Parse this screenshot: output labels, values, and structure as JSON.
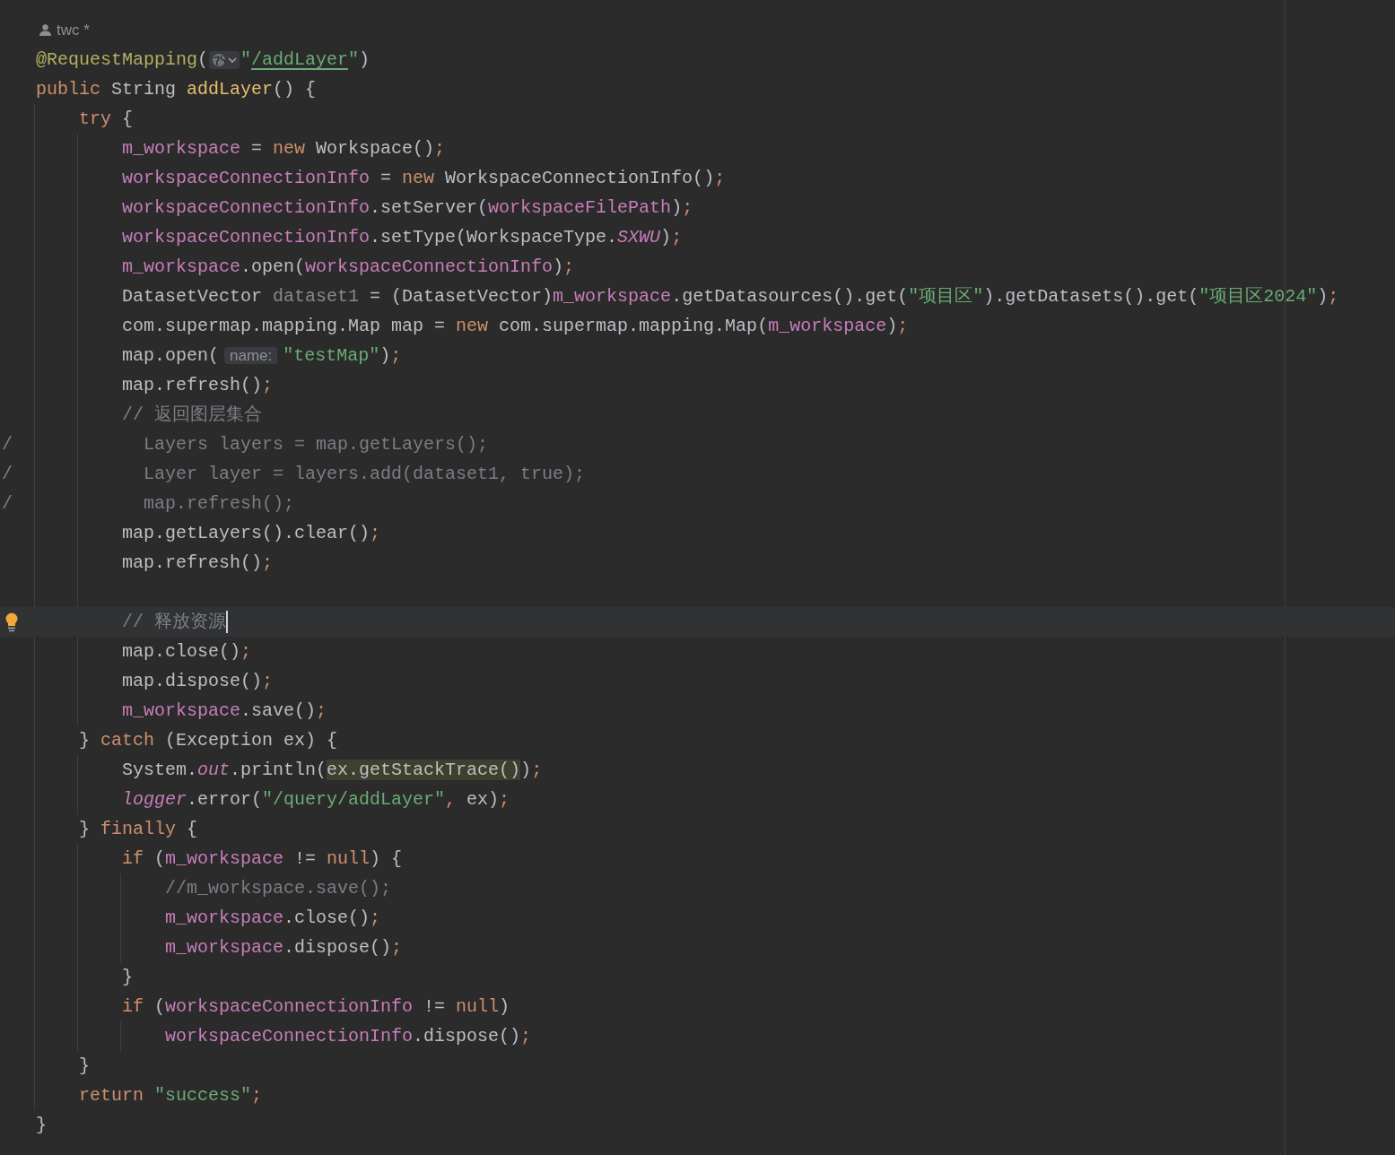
{
  "author": {
    "name": "twc *"
  },
  "lines": [
    {
      "kind": "code",
      "tokens": [
        {
          "kind": "ann",
          "text": "@RequestMapping"
        },
        {
          "kind": "plain",
          "text": "("
        },
        {
          "kind": "web-icon"
        },
        {
          "kind": "str",
          "text": "\""
        },
        {
          "kind": "link",
          "text": "/addLayer"
        },
        {
          "kind": "str",
          "text": "\""
        },
        {
          "kind": "plain",
          "text": ")"
        }
      ]
    },
    {
      "kind": "code",
      "tokens": [
        {
          "kind": "kw",
          "text": "public "
        },
        {
          "kind": "plain",
          "text": "String "
        },
        {
          "kind": "decl",
          "text": "addLayer"
        },
        {
          "kind": "plain",
          "text": "() {"
        }
      ],
      "children": [
        {
          "kind": "code",
          "tokens": [
            {
              "kind": "kw",
              "text": "try "
            },
            {
              "kind": "plain",
              "text": "{"
            }
          ],
          "children": [
            {
              "kind": "code",
              "tokens": [
                {
                  "kind": "field",
                  "text": "m_workspace"
                },
                {
                  "kind": "plain",
                  "text": " = "
                },
                {
                  "kind": "kw",
                  "text": "new "
                },
                {
                  "kind": "plain",
                  "text": "Workspace()"
                },
                {
                  "kind": "punct",
                  "text": ";"
                }
              ]
            },
            {
              "kind": "code",
              "tokens": [
                {
                  "kind": "field",
                  "text": "workspaceConnectionInfo"
                },
                {
                  "kind": "plain",
                  "text": " = "
                },
                {
                  "kind": "kw",
                  "text": "new "
                },
                {
                  "kind": "plain",
                  "text": "WorkspaceConnectionInfo()"
                },
                {
                  "kind": "punct",
                  "text": ";"
                }
              ]
            },
            {
              "kind": "code",
              "tokens": [
                {
                  "kind": "field",
                  "text": "workspaceConnectionInfo"
                },
                {
                  "kind": "plain",
                  "text": ".setServer("
                },
                {
                  "kind": "field",
                  "text": "workspaceFilePath"
                },
                {
                  "kind": "plain",
                  "text": ")"
                },
                {
                  "kind": "punct",
                  "text": ";"
                }
              ]
            },
            {
              "kind": "code",
              "tokens": [
                {
                  "kind": "field",
                  "text": "workspaceConnectionInfo"
                },
                {
                  "kind": "plain",
                  "text": ".setType(WorkspaceType."
                },
                {
                  "kind": "static",
                  "text": "SXWU"
                },
                {
                  "kind": "plain",
                  "text": ")"
                },
                {
                  "kind": "punct",
                  "text": ";"
                }
              ]
            },
            {
              "kind": "code",
              "tokens": [
                {
                  "kind": "field",
                  "text": "m_workspace"
                },
                {
                  "kind": "plain",
                  "text": ".open("
                },
                {
                  "kind": "field",
                  "text": "workspaceConnectionInfo"
                },
                {
                  "kind": "plain",
                  "text": ")"
                },
                {
                  "kind": "punct",
                  "text": ";"
                }
              ]
            },
            {
              "kind": "code",
              "tokens": [
                {
                  "kind": "plain",
                  "text": "DatasetVector "
                },
                {
                  "kind": "unused",
                  "text": "dataset1"
                },
                {
                  "kind": "plain",
                  "text": " = (DatasetVector)"
                },
                {
                  "kind": "field",
                  "text": "m_workspace"
                },
                {
                  "kind": "plain",
                  "text": ".getDatasources().get("
                },
                {
                  "kind": "str",
                  "text": "\"项目区\""
                },
                {
                  "kind": "plain",
                  "text": ").getDatasets().get("
                },
                {
                  "kind": "str",
                  "text": "\"项目区2024\""
                },
                {
                  "kind": "plain",
                  "text": ")"
                },
                {
                  "kind": "punct",
                  "text": ";"
                }
              ]
            },
            {
              "kind": "code",
              "tokens": [
                {
                  "kind": "plain",
                  "text": "com.supermap.mapping.Map map = "
                },
                {
                  "kind": "kw",
                  "text": "new "
                },
                {
                  "kind": "plain",
                  "text": "com.supermap.mapping.Map("
                },
                {
                  "kind": "field",
                  "text": "m_workspace"
                },
                {
                  "kind": "plain",
                  "text": ")"
                },
                {
                  "kind": "punct",
                  "text": ";"
                }
              ]
            },
            {
              "kind": "code",
              "tokens": [
                {
                  "kind": "plain",
                  "text": "map.open("
                },
                {
                  "kind": "hint",
                  "text": "name:"
                },
                {
                  "kind": "str",
                  "text": "\"testMap\""
                },
                {
                  "kind": "plain",
                  "text": ")"
                },
                {
                  "kind": "punct",
                  "text": ";"
                }
              ]
            },
            {
              "kind": "code",
              "tokens": [
                {
                  "kind": "plain",
                  "text": "map.refresh()"
                },
                {
                  "kind": "punct",
                  "text": ";"
                }
              ]
            },
            {
              "kind": "code",
              "tokens": [
                {
                  "kind": "comment",
                  "text": "// 返回图层集合"
                }
              ]
            },
            {
              "kind": "commented",
              "marker": "/",
              "tokens": [
                {
                  "kind": "comment",
                  "text": "Layers layers = map.getLayers();"
                }
              ]
            },
            {
              "kind": "commented",
              "marker": "/",
              "tokens": [
                {
                  "kind": "comment",
                  "text": "Layer layer = layers.add(dataset1, true);"
                }
              ]
            },
            {
              "kind": "commented",
              "marker": "/",
              "tokens": [
                {
                  "kind": "comment",
                  "text": "map.refresh();"
                }
              ]
            },
            {
              "kind": "code",
              "tokens": [
                {
                  "kind": "plain",
                  "text": "map.getLayers().clear()"
                },
                {
                  "kind": "punct",
                  "text": ";"
                }
              ]
            },
            {
              "kind": "code",
              "tokens": [
                {
                  "kind": "plain",
                  "text": "map.refresh()"
                },
                {
                  "kind": "punct",
                  "text": ";"
                }
              ]
            },
            {
              "kind": "blank"
            },
            {
              "kind": "current",
              "tokens": [
                {
                  "kind": "comment",
                  "text": "// 释放资源"
                }
              ]
            },
            {
              "kind": "code",
              "tokens": [
                {
                  "kind": "plain",
                  "text": "map.close()"
                },
                {
                  "kind": "punct",
                  "text": ";"
                }
              ]
            },
            {
              "kind": "code",
              "tokens": [
                {
                  "kind": "plain",
                  "text": "map.dispose()"
                },
                {
                  "kind": "punct",
                  "text": ";"
                }
              ]
            },
            {
              "kind": "code",
              "tokens": [
                {
                  "kind": "field",
                  "text": "m_workspace"
                },
                {
                  "kind": "plain",
                  "text": ".save()"
                },
                {
                  "kind": "punct",
                  "text": ";"
                }
              ]
            }
          ]
        },
        {
          "kind": "code",
          "tokens": [
            {
              "kind": "plain",
              "text": "} "
            },
            {
              "kind": "kw",
              "text": "catch "
            },
            {
              "kind": "plain",
              "text": "(Exception ex) {"
            }
          ],
          "children": [
            {
              "kind": "code",
              "tokens": [
                {
                  "kind": "plain",
                  "text": "System."
                },
                {
                  "kind": "static",
                  "text": "out"
                },
                {
                  "kind": "plain",
                  "text": ".println("
                },
                {
                  "kind": "match",
                  "text": "ex.getStackTrace()"
                },
                {
                  "kind": "plain",
                  "text": ")"
                },
                {
                  "kind": "punct",
                  "text": ";"
                }
              ]
            },
            {
              "kind": "code",
              "tokens": [
                {
                  "kind": "static",
                  "text": "logger"
                },
                {
                  "kind": "plain",
                  "text": ".error("
                },
                {
                  "kind": "str",
                  "text": "\"/query/addLayer\""
                },
                {
                  "kind": "punct",
                  "text": ", "
                },
                {
                  "kind": "plain",
                  "text": "ex)"
                },
                {
                  "kind": "punct",
                  "text": ";"
                }
              ]
            }
          ]
        },
        {
          "kind": "code",
          "tokens": [
            {
              "kind": "plain",
              "text": "} "
            },
            {
              "kind": "kw",
              "text": "finally "
            },
            {
              "kind": "plain",
              "text": "{"
            }
          ],
          "children": [
            {
              "kind": "code",
              "tokens": [
                {
                  "kind": "kw",
                  "text": "if "
                },
                {
                  "kind": "plain",
                  "text": "("
                },
                {
                  "kind": "field",
                  "text": "m_workspace"
                },
                {
                  "kind": "plain",
                  "text": " != "
                },
                {
                  "kind": "kw",
                  "text": "null"
                },
                {
                  "kind": "plain",
                  "text": ") {"
                }
              ],
              "children": [
                {
                  "kind": "code",
                  "tokens": [
                    {
                      "kind": "comment",
                      "text": "//m_workspace.save();"
                    }
                  ]
                },
                {
                  "kind": "code",
                  "tokens": [
                    {
                      "kind": "field",
                      "text": "m_workspace"
                    },
                    {
                      "kind": "plain",
                      "text": ".close()"
                    },
                    {
                      "kind": "punct",
                      "text": ";"
                    }
                  ]
                },
                {
                  "kind": "code",
                  "tokens": [
                    {
                      "kind": "field",
                      "text": "m_workspace"
                    },
                    {
                      "kind": "plain",
                      "text": ".dispose()"
                    },
                    {
                      "kind": "punct",
                      "text": ";"
                    }
                  ]
                }
              ]
            },
            {
              "kind": "code",
              "tokens": [
                {
                  "kind": "plain",
                  "text": "}"
                }
              ]
            },
            {
              "kind": "code",
              "tokens": [
                {
                  "kind": "kw",
                  "text": "if "
                },
                {
                  "kind": "plain",
                  "text": "("
                },
                {
                  "kind": "field",
                  "text": "workspaceConnectionInfo"
                },
                {
                  "kind": "plain",
                  "text": " != "
                },
                {
                  "kind": "kw",
                  "text": "null"
                },
                {
                  "kind": "plain",
                  "text": ")"
                }
              ],
              "children": [
                {
                  "kind": "code",
                  "tokens": [
                    {
                      "kind": "field",
                      "text": "workspaceConnectionInfo"
                    },
                    {
                      "kind": "plain",
                      "text": ".dispose()"
                    },
                    {
                      "kind": "punct",
                      "text": ";"
                    }
                  ]
                }
              ]
            }
          ]
        },
        {
          "kind": "code",
          "tokens": [
            {
              "kind": "plain",
              "text": "}"
            }
          ]
        },
        {
          "kind": "code",
          "tokens": [
            {
              "kind": "kw",
              "text": "return "
            },
            {
              "kind": "str",
              "text": "\"success\""
            },
            {
              "kind": "punct",
              "text": ";"
            }
          ]
        }
      ]
    },
    {
      "kind": "code",
      "tokens": [
        {
          "kind": "plain",
          "text": "}"
        }
      ]
    }
  ]
}
